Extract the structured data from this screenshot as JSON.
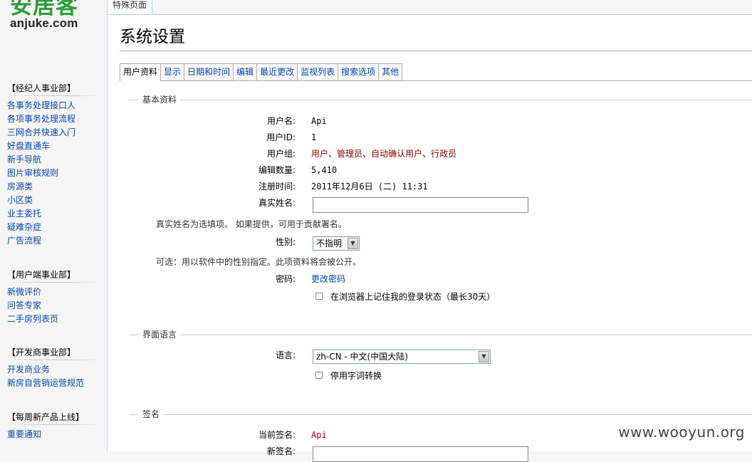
{
  "logo": {
    "brand": "安居客",
    "domain": "anjuke.com"
  },
  "special_tab": "特殊页面",
  "page_title": "系统设置",
  "sidebar": {
    "sections": [
      {
        "title": "【经纪人事业部】",
        "items": [
          "各事务处理接口人",
          "各项事务处理流程",
          "三网合并快速入门",
          "好盘直通车",
          "新手导航",
          "图片审核规则",
          "房源类",
          "小区类",
          "业主委托",
          "疑难杂症",
          "广告流程"
        ]
      },
      {
        "title": "【用户端事业部】",
        "items": [
          "新微评价",
          "问答专家",
          "二手房列表页"
        ]
      },
      {
        "title": "【开发商事业部】",
        "items": [
          "开发商业务",
          "新房自营销运营规范"
        ]
      },
      {
        "title": "【每周新产品上线】",
        "items": [
          "重要通知"
        ]
      }
    ]
  },
  "pref_tabs": [
    "用户资料",
    "显示",
    "日期和时间",
    "编辑",
    "最近更改",
    "监视列表",
    "搜索选项",
    "其他"
  ],
  "basic": {
    "legend": "基本资料",
    "username_label": "用户名:",
    "username": "Api",
    "userid_label": "用户ID:",
    "userid": "1",
    "groups_label": "用户组:",
    "groups": [
      "用户",
      "管理员",
      "自动确认用户",
      "行政员"
    ],
    "groups_sep": "、",
    "edits_label": "编辑数量:",
    "edits": "5,410",
    "registered_label": "注册时间:",
    "registered": "2011年12月6日 (二) 11:31",
    "realname_label": "真实姓名:",
    "realname_value": "",
    "realname_help": "真实姓名为选填项。 如果提供，可用于贡献署名。",
    "gender_label": "性别:",
    "gender_value": "不指明",
    "gender_help": "可选：用以软件中的性别指定。此项资料将会被公开。",
    "password_label": "密码:",
    "password_link": "更改密码",
    "remember_label": "在浏览器上记住我的登录状态（最长30天）"
  },
  "language": {
    "legend": "界面语言",
    "label": "语言:",
    "value": "zh-CN - 中文(中国大陆)",
    "disable_conversion_label": "停用字词转换"
  },
  "signature": {
    "legend": "签名",
    "current_label": "当前签名:",
    "current_value": "Api",
    "new_label": "新签名:"
  },
  "watermark": "www.wooyun.org",
  "colors": {
    "link": "#0645ad",
    "group_link": "#8b0000",
    "logo_green": "#2f9c3a",
    "border": "#a7d7f9"
  }
}
